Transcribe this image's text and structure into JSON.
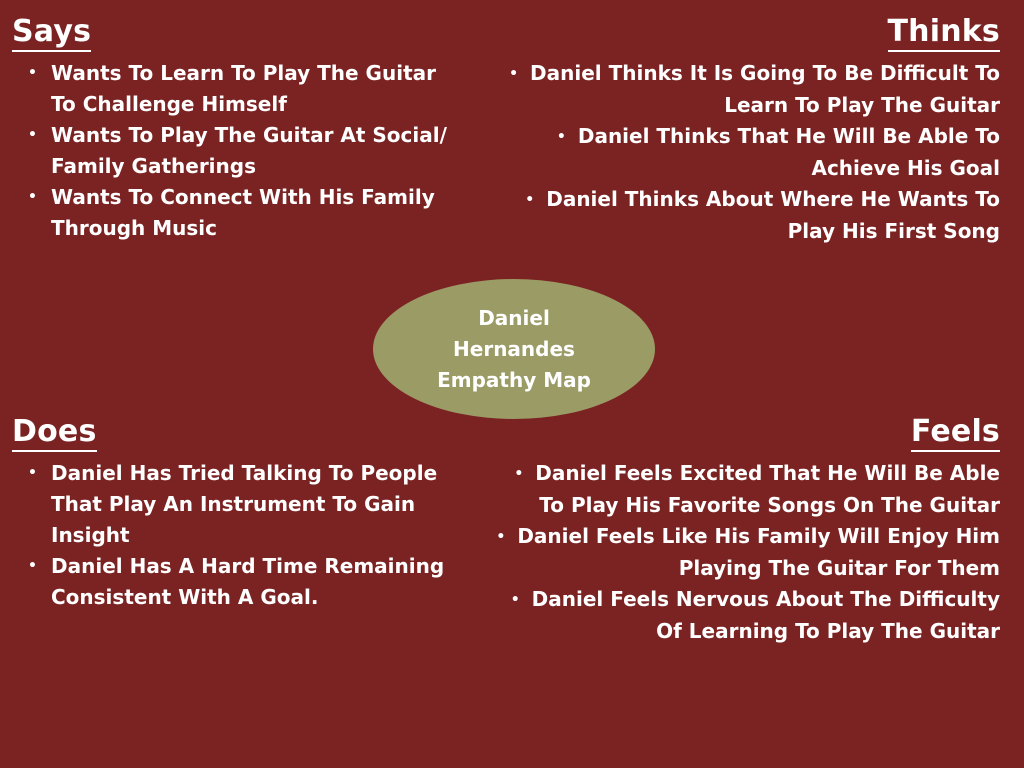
{
  "colors": {
    "background": "#7b2323",
    "ellipse": "#9b9b66",
    "text": "#ffffff"
  },
  "center": {
    "title": "Daniel Hernandes Empathy Map"
  },
  "says": {
    "heading": "Says",
    "items": [
      "Wants To Learn To Play The Guitar To Challenge Himself",
      "Wants To Play The Guitar At Social/ Family Gatherings",
      "Wants To Connect With His Family Through Music"
    ]
  },
  "thinks": {
    "heading": "Thinks",
    "items": [
      "Daniel Thinks It Is Going To Be Difficult To Learn To Play The Guitar",
      "Daniel Thinks That He Will Be Able To Achieve His Goal",
      "Daniel Thinks About Where He Wants To Play His First Song"
    ]
  },
  "does": {
    "heading": "Does",
    "items": [
      "Daniel Has Tried Talking To People That Play An Instrument To Gain Insight",
      "Daniel Has A Hard Time Remaining Consistent With A Goal."
    ]
  },
  "feels": {
    "heading": "Feels",
    "items": [
      "Daniel Feels Excited That He Will Be Able To Play His Favorite Songs On The Guitar",
      "Daniel Feels Like His Family Will Enjoy Him Playing The Guitar For Them",
      "Daniel Feels Nervous About The Difficulty Of Learning To Play The Guitar"
    ]
  }
}
